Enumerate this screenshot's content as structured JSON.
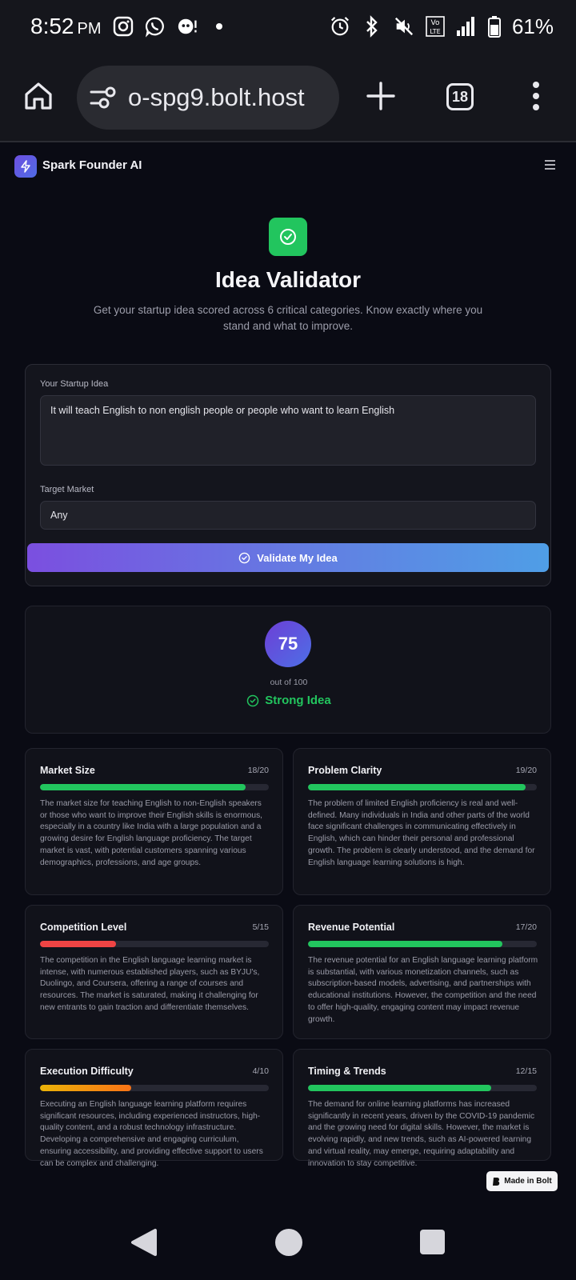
{
  "status_bar": {
    "time": "8:52",
    "ampm": "PM",
    "battery_pct": "61%",
    "lte_label": "Vo LTE",
    "icons": [
      "instagram-icon",
      "whatsapp-icon",
      "chat-bot-icon",
      "dot-icon",
      "alarm-icon",
      "bluetooth-icon",
      "mute-icon",
      "lte-icon",
      "signal-icon",
      "battery-icon"
    ]
  },
  "browser": {
    "url": "o-spg9.bolt.host",
    "tab_count": "18"
  },
  "app": {
    "brand": "Spark Founder AI",
    "title": "Idea Validator",
    "subtitle": "Get your startup idea scored across 6 critical categories. Know exactly where you stand and what to improve."
  },
  "form": {
    "idea_label": "Your Startup Idea",
    "idea_value": "It will teach English to non english people or people who want to learn English",
    "market_label": "Target Market",
    "market_value": "Any",
    "validate_label": "Validate My Idea"
  },
  "score": {
    "value": "75",
    "out_of": "out of 100",
    "verdict": "Strong Idea"
  },
  "categories": [
    {
      "name": "Market Size",
      "score": "18/20",
      "fraction": 0.9,
      "color": "#22c55e",
      "desc": "The market size for teaching English to non-English speakers or those who want to improve their English skills is enormous, especially in a country like India with a large population and a growing desire for English language proficiency. The target market is vast, with potential customers spanning various demographics, professions, and age groups."
    },
    {
      "name": "Problem Clarity",
      "score": "19/20",
      "fraction": 0.95,
      "color": "#22c55e",
      "desc": "The problem of limited English proficiency is real and well-defined. Many individuals in India and other parts of the world face significant challenges in communicating effectively in English, which can hinder their personal and professional growth. The problem is clearly understood, and the demand for English language learning solutions is high."
    },
    {
      "name": "Competition Level",
      "score": "5/15",
      "fraction": 0.333,
      "color": "#ef4444",
      "desc": "The competition in the English language learning market is intense, with numerous established players, such as BYJU's, Duolingo, and Coursera, offering a range of courses and resources. The market is saturated, making it challenging for new entrants to gain traction and differentiate themselves."
    },
    {
      "name": "Revenue Potential",
      "score": "17/20",
      "fraction": 0.85,
      "color": "#22c55e",
      "desc": "The revenue potential for an English language learning platform is substantial, with various monetization channels, such as subscription-based models, advertising, and partnerships with educational institutions. However, the competition and the need to offer high-quality, engaging content may impact revenue growth."
    },
    {
      "name": "Execution Difficulty",
      "score": "4/10",
      "fraction": 0.4,
      "color": "#f59e0b",
      "desc": "Executing an English language learning platform requires significant resources, including experienced instructors, high-quality content, and a robust technology infrastructure. Developing a comprehensive and engaging curriculum, ensuring accessibility, and providing effective support to users can be complex and challenging."
    },
    {
      "name": "Timing & Trends",
      "score": "12/15",
      "fraction": 0.8,
      "color": "#22c55e",
      "desc": "The demand for online learning platforms has increased significantly in recent years, driven by the COVID-19 pandemic and the growing need for digital skills. However, the market is evolving rapidly, and new trends, such as AI-powered learning and virtual reality, may emerge, requiring adaptability and innovation to stay competitive."
    }
  ],
  "badge": {
    "label": "Made in Bolt"
  },
  "colors": {
    "accent": "#6d4fe0",
    "success": "#22c55e",
    "danger": "#ef4444",
    "warning": "#f59e0b",
    "background": "#0a0b14"
  }
}
